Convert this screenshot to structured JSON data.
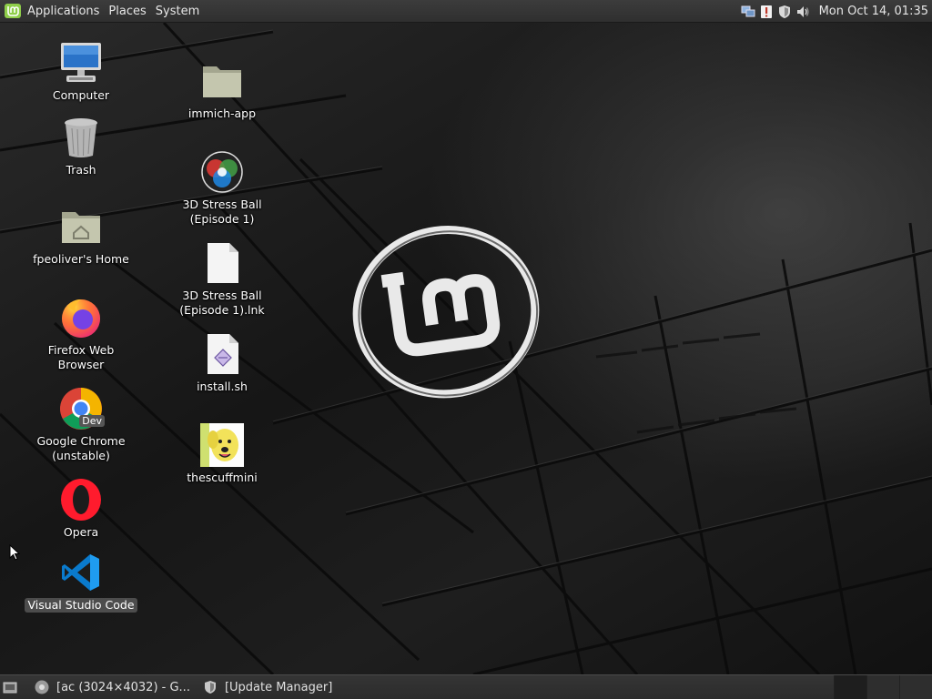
{
  "top_panel": {
    "menus": [
      "Applications",
      "Places",
      "System"
    ],
    "clock": "Mon Oct 14, 01:35",
    "tray_icons": [
      "network-icon",
      "update-notice-icon",
      "shield-icon",
      "volume-icon"
    ]
  },
  "desktop": {
    "icons": [
      {
        "name": "Computer",
        "icon": "computer-icon"
      },
      {
        "name": "Trash",
        "icon": "trash-icon"
      },
      {
        "name": "fpeoliver's Home",
        "icon": "home-folder-icon"
      },
      {
        "name": "Firefox Web Browser",
        "icon": "firefox-icon"
      },
      {
        "name": "Google Chrome\n(unstable)",
        "line1": "Google Chrome",
        "line2": "(unstable)",
        "icon": "chrome-dev-icon",
        "badge": "Dev"
      },
      {
        "name": "Opera",
        "icon": "opera-icon"
      },
      {
        "name": "Visual Studio Code",
        "icon": "vscode-icon",
        "selected": true
      },
      {
        "name": "immich-app",
        "icon": "folder-icon"
      },
      {
        "line1": "3D Stress Ball",
        "line2": "(Episode 1)",
        "icon": "stress-ball-icon"
      },
      {
        "line1": "3D Stress Ball",
        "line2": "(Episode 1).lnk",
        "icon": "file-icon"
      },
      {
        "name": "install.sh",
        "icon": "script-icon"
      },
      {
        "name": "thescuffmini",
        "icon": "dog-thumbnail-icon"
      }
    ]
  },
  "bottom_panel": {
    "tasks": [
      {
        "label": "[ac (3024×4032) - G...",
        "icon": "chrome-icon"
      },
      {
        "label": "[Update Manager]",
        "icon": "shield-icon"
      }
    ]
  },
  "colors": {
    "mint_green": "#8fce4a",
    "panel_bg": "#323232",
    "firefox_orange": "#ff7139",
    "opera_red": "#ff1b2d",
    "vscode_blue": "#0a7acc"
  }
}
